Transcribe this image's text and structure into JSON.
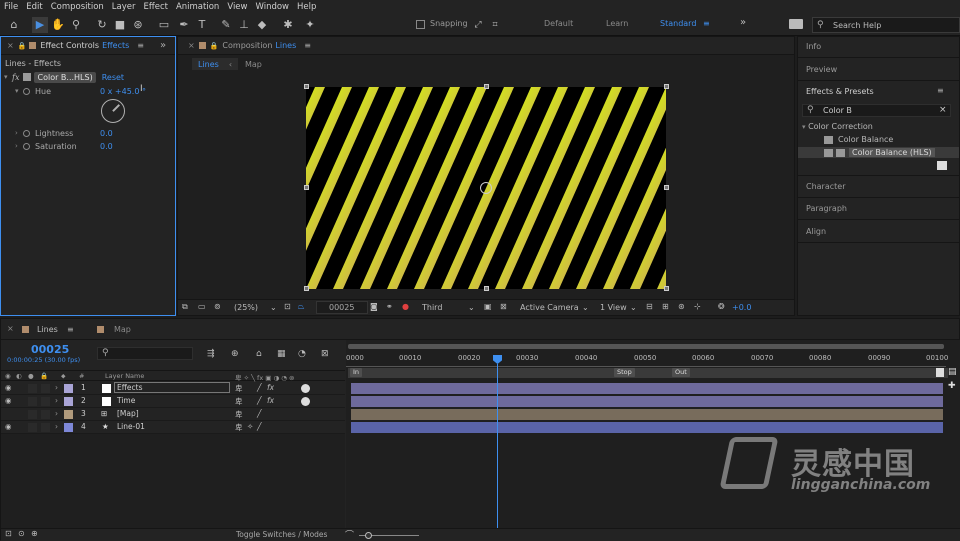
{
  "menu": [
    "File",
    "Edit",
    "Composition",
    "Layer",
    "Effect",
    "Animation",
    "View",
    "Window",
    "Help"
  ],
  "toolbar": {
    "snapping_label": "Snapping",
    "workspaces": [
      "Default",
      "Learn",
      "Standard"
    ],
    "search_placeholder": "Search Help"
  },
  "effect_controls": {
    "tab_label": "Effect Controls",
    "tab_layer": "Effects",
    "breadcrumb": "Lines - Effects",
    "effect_name": "Color B...HLS)",
    "reset_label": "Reset",
    "props": [
      {
        "label": "Hue",
        "value": "0 x +45.0 °"
      },
      {
        "label": "Lightness",
        "value": "0.0"
      },
      {
        "label": "Saturation",
        "value": "0.0"
      }
    ]
  },
  "composition": {
    "tab_label": "Composition",
    "tab_comp": "Lines",
    "sub_tabs": [
      "Lines",
      "Map"
    ],
    "zoom": "(25%)",
    "timecode": "00025",
    "resolution": "Third",
    "camera": "Active Camera",
    "views": "1 View",
    "exposure": "+0.0"
  },
  "right_panel": {
    "items": [
      "Info",
      "Preview",
      "Effects & Presets",
      "Character",
      "Paragraph",
      "Align"
    ],
    "search_value": "Color B",
    "category": "Color Correction",
    "results": [
      "Color Balance",
      "Color Balance (HLS)"
    ]
  },
  "timeline": {
    "tabs": [
      "Lines",
      "Map"
    ],
    "current_time": "00025",
    "fps": "0:00:00:25 (30.00 fps)",
    "col_layer_name": "Layer Name",
    "col_num": "#",
    "ruler_labels": [
      "0000",
      "00010",
      "00020",
      "00030",
      "00040",
      "00050",
      "00060",
      "00070",
      "00080",
      "00090",
      "00100"
    ],
    "markers": [
      "In",
      "Stop",
      "Out"
    ],
    "layers": [
      {
        "num": "1",
        "name": "Effects"
      },
      {
        "num": "2",
        "name": "Time"
      },
      {
        "num": "3",
        "name": "[Map]"
      },
      {
        "num": "4",
        "name": "Line-01"
      }
    ],
    "toggle_label": "Toggle Switches / Modes"
  },
  "watermark": {
    "brand": "灵感中国",
    "url": "lingganchina.com"
  },
  "colors": {
    "accent": "#3e8ff0",
    "layer_purple": "#6e6a9c",
    "layer_tan": "#786c5c",
    "layer_blue": "#5a64a8"
  }
}
